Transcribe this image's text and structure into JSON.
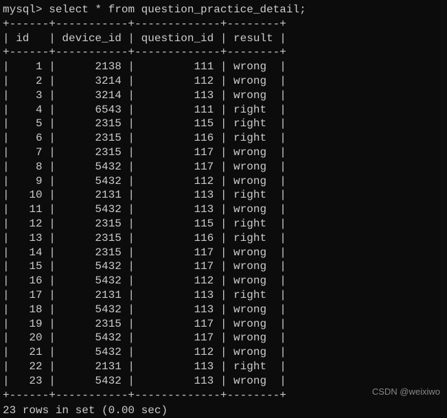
{
  "prompt_prefix": "mysql> ",
  "query": "select * from question_practice_detail;",
  "divider": "+------+-----------+-------------+--------+",
  "columns": [
    "id",
    "device_id",
    "question_id",
    "result"
  ],
  "header_line": "| id   | device_id | question_id | result |",
  "rows": [
    {
      "id": 1,
      "device_id": 2138,
      "question_id": 111,
      "result": "wrong"
    },
    {
      "id": 2,
      "device_id": 3214,
      "question_id": 112,
      "result": "wrong"
    },
    {
      "id": 3,
      "device_id": 3214,
      "question_id": 113,
      "result": "wrong"
    },
    {
      "id": 4,
      "device_id": 6543,
      "question_id": 111,
      "result": "right"
    },
    {
      "id": 5,
      "device_id": 2315,
      "question_id": 115,
      "result": "right"
    },
    {
      "id": 6,
      "device_id": 2315,
      "question_id": 116,
      "result": "right"
    },
    {
      "id": 7,
      "device_id": 2315,
      "question_id": 117,
      "result": "wrong"
    },
    {
      "id": 8,
      "device_id": 5432,
      "question_id": 117,
      "result": "wrong"
    },
    {
      "id": 9,
      "device_id": 5432,
      "question_id": 112,
      "result": "wrong"
    },
    {
      "id": 10,
      "device_id": 2131,
      "question_id": 113,
      "result": "right"
    },
    {
      "id": 11,
      "device_id": 5432,
      "question_id": 113,
      "result": "wrong"
    },
    {
      "id": 12,
      "device_id": 2315,
      "question_id": 115,
      "result": "right"
    },
    {
      "id": 13,
      "device_id": 2315,
      "question_id": 116,
      "result": "right"
    },
    {
      "id": 14,
      "device_id": 2315,
      "question_id": 117,
      "result": "wrong"
    },
    {
      "id": 15,
      "device_id": 5432,
      "question_id": 117,
      "result": "wrong"
    },
    {
      "id": 16,
      "device_id": 5432,
      "question_id": 112,
      "result": "wrong"
    },
    {
      "id": 17,
      "device_id": 2131,
      "question_id": 113,
      "result": "right"
    },
    {
      "id": 18,
      "device_id": 5432,
      "question_id": 113,
      "result": "wrong"
    },
    {
      "id": 19,
      "device_id": 2315,
      "question_id": 117,
      "result": "wrong"
    },
    {
      "id": 20,
      "device_id": 5432,
      "question_id": 117,
      "result": "wrong"
    },
    {
      "id": 21,
      "device_id": 5432,
      "question_id": 112,
      "result": "wrong"
    },
    {
      "id": 22,
      "device_id": 2131,
      "question_id": 113,
      "result": "right"
    },
    {
      "id": 23,
      "device_id": 5432,
      "question_id": 113,
      "result": "wrong"
    }
  ],
  "footer_text": "23 rows in set (0.00 sec)",
  "watermark": "CSDN @weixiwo",
  "chart_data": {
    "type": "table",
    "title": "question_practice_detail",
    "columns": [
      "id",
      "device_id",
      "question_id",
      "result"
    ],
    "data": [
      [
        1,
        2138,
        111,
        "wrong"
      ],
      [
        2,
        3214,
        112,
        "wrong"
      ],
      [
        3,
        3214,
        113,
        "wrong"
      ],
      [
        4,
        6543,
        111,
        "right"
      ],
      [
        5,
        2315,
        115,
        "right"
      ],
      [
        6,
        2315,
        116,
        "right"
      ],
      [
        7,
        2315,
        117,
        "wrong"
      ],
      [
        8,
        5432,
        117,
        "wrong"
      ],
      [
        9,
        5432,
        112,
        "wrong"
      ],
      [
        10,
        2131,
        113,
        "right"
      ],
      [
        11,
        5432,
        113,
        "wrong"
      ],
      [
        12,
        2315,
        115,
        "right"
      ],
      [
        13,
        2315,
        116,
        "right"
      ],
      [
        14,
        2315,
        117,
        "wrong"
      ],
      [
        15,
        5432,
        117,
        "wrong"
      ],
      [
        16,
        5432,
        112,
        "wrong"
      ],
      [
        17,
        2131,
        113,
        "right"
      ],
      [
        18,
        5432,
        113,
        "wrong"
      ],
      [
        19,
        2315,
        117,
        "wrong"
      ],
      [
        20,
        5432,
        117,
        "wrong"
      ],
      [
        21,
        5432,
        112,
        "wrong"
      ],
      [
        22,
        2131,
        113,
        "right"
      ],
      [
        23,
        5432,
        113,
        "wrong"
      ]
    ]
  }
}
